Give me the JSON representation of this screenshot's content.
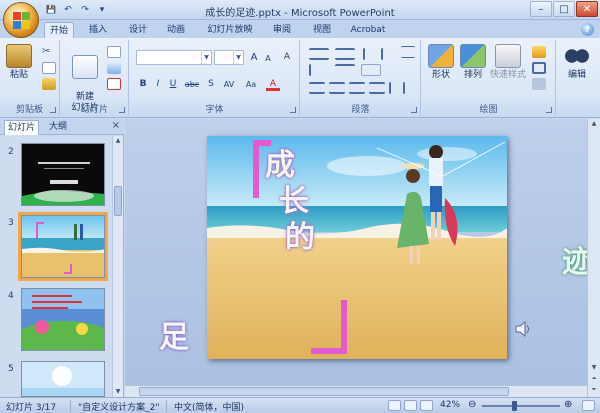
{
  "window": {
    "title": "成长的足迹.pptx - Microsoft PowerPoint",
    "controls": {
      "minimize": "–",
      "maximize": "□",
      "close": "✕"
    }
  },
  "qat": {
    "save": "💾",
    "undo": "↶",
    "redo": "↷",
    "customize": "▾"
  },
  "tabs": [
    {
      "label": "开始",
      "active": true
    },
    {
      "label": "插入"
    },
    {
      "label": "设计"
    },
    {
      "label": "动画"
    },
    {
      "label": "幻灯片放映"
    },
    {
      "label": "审阅"
    },
    {
      "label": "视图"
    },
    {
      "label": "Acrobat"
    }
  ],
  "ribbon": {
    "clipboard": {
      "label": "剪贴板",
      "paste": "粘贴"
    },
    "slides": {
      "label": "幻灯片",
      "new_slide": "新建\n幻灯片"
    },
    "font": {
      "label": "字体",
      "font_name": "",
      "font_size": "",
      "grow": "A",
      "shrink": "A",
      "clear": "A",
      "bold": "B",
      "italic": "I",
      "underline": "U",
      "strike": "abc",
      "shadow": "S",
      "spacing": "AV",
      "case": "Aa",
      "color": "A"
    },
    "paragraph": {
      "label": "段落"
    },
    "drawing": {
      "label": "绘图",
      "shapes": "形状",
      "arrange": "排列",
      "quick_styles": "快速样式"
    },
    "editing": {
      "label": "",
      "edit": "编辑"
    }
  },
  "panel": {
    "tabs": [
      {
        "label": "幻灯片",
        "active": true
      },
      {
        "label": "大纲"
      }
    ],
    "close": "×",
    "thumbs": [
      {
        "num": "2"
      },
      {
        "num": "3",
        "selected": true
      },
      {
        "num": "4"
      },
      {
        "num": "5"
      }
    ]
  },
  "slide": {
    "title_chars": [
      "成",
      "长",
      "的"
    ],
    "outside_right": "迹",
    "outside_left": "足"
  },
  "status": {
    "slide_info": "幻灯片 3/17",
    "theme": "\"自定义设计方案_2\"",
    "language": "中文(简体，中国)",
    "zoom": "42%",
    "zoom_out": "⊖",
    "zoom_in": "⊕"
  },
  "colors": {
    "accent_magenta": "#e25ad0",
    "sky": "#7ec3ec",
    "sand": "#e8c06a",
    "sea": "#38a9c8"
  }
}
